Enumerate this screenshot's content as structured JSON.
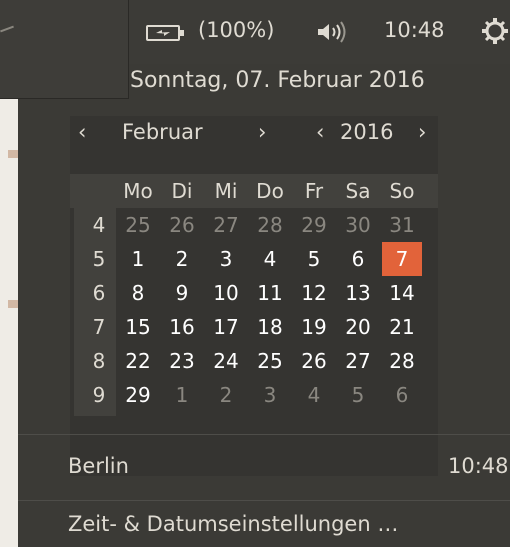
{
  "panel": {
    "battery_text": "(100%)",
    "clock": "10:48"
  },
  "menu": {
    "date_heading": "Sonntag, 07. Februar 2016",
    "month_prev": "‹",
    "month": "Februar",
    "month_next": "›",
    "year_prev": "‹",
    "year": "2016",
    "year_next": "›",
    "weekdays": [
      "Mo",
      "Di",
      "Mi",
      "Do",
      "Fr",
      "Sa",
      "So"
    ],
    "weeks": [
      {
        "num": "4",
        "days": [
          "25",
          "26",
          "27",
          "28",
          "29",
          "30",
          "31"
        ],
        "in": [
          false,
          false,
          false,
          false,
          false,
          false,
          false
        ]
      },
      {
        "num": "5",
        "days": [
          "1",
          "2",
          "3",
          "4",
          "5",
          "6",
          "7"
        ],
        "in": [
          true,
          true,
          true,
          true,
          true,
          true,
          true
        ]
      },
      {
        "num": "6",
        "days": [
          "8",
          "9",
          "10",
          "11",
          "12",
          "13",
          "14"
        ],
        "in": [
          true,
          true,
          true,
          true,
          true,
          true,
          true
        ]
      },
      {
        "num": "7",
        "days": [
          "15",
          "16",
          "17",
          "18",
          "19",
          "20",
          "21"
        ],
        "in": [
          true,
          true,
          true,
          true,
          true,
          true,
          true
        ]
      },
      {
        "num": "8",
        "days": [
          "22",
          "23",
          "24",
          "25",
          "26",
          "27",
          "28"
        ],
        "in": [
          true,
          true,
          true,
          true,
          true,
          true,
          true
        ]
      },
      {
        "num": "9",
        "days": [
          "29",
          "1",
          "2",
          "3",
          "4",
          "5",
          "6"
        ],
        "in": [
          true,
          false,
          false,
          false,
          false,
          false,
          false
        ]
      }
    ],
    "today": "7",
    "location": "Berlin",
    "location_time": "10:48",
    "settings_link": "Zeit- & Datumseinstellungen …"
  },
  "colors": {
    "accent": "#e2633a",
    "panel_bg": "#3c3b37"
  },
  "icons": [
    "battery-icon",
    "volume-icon",
    "settings-gear-icon"
  ]
}
